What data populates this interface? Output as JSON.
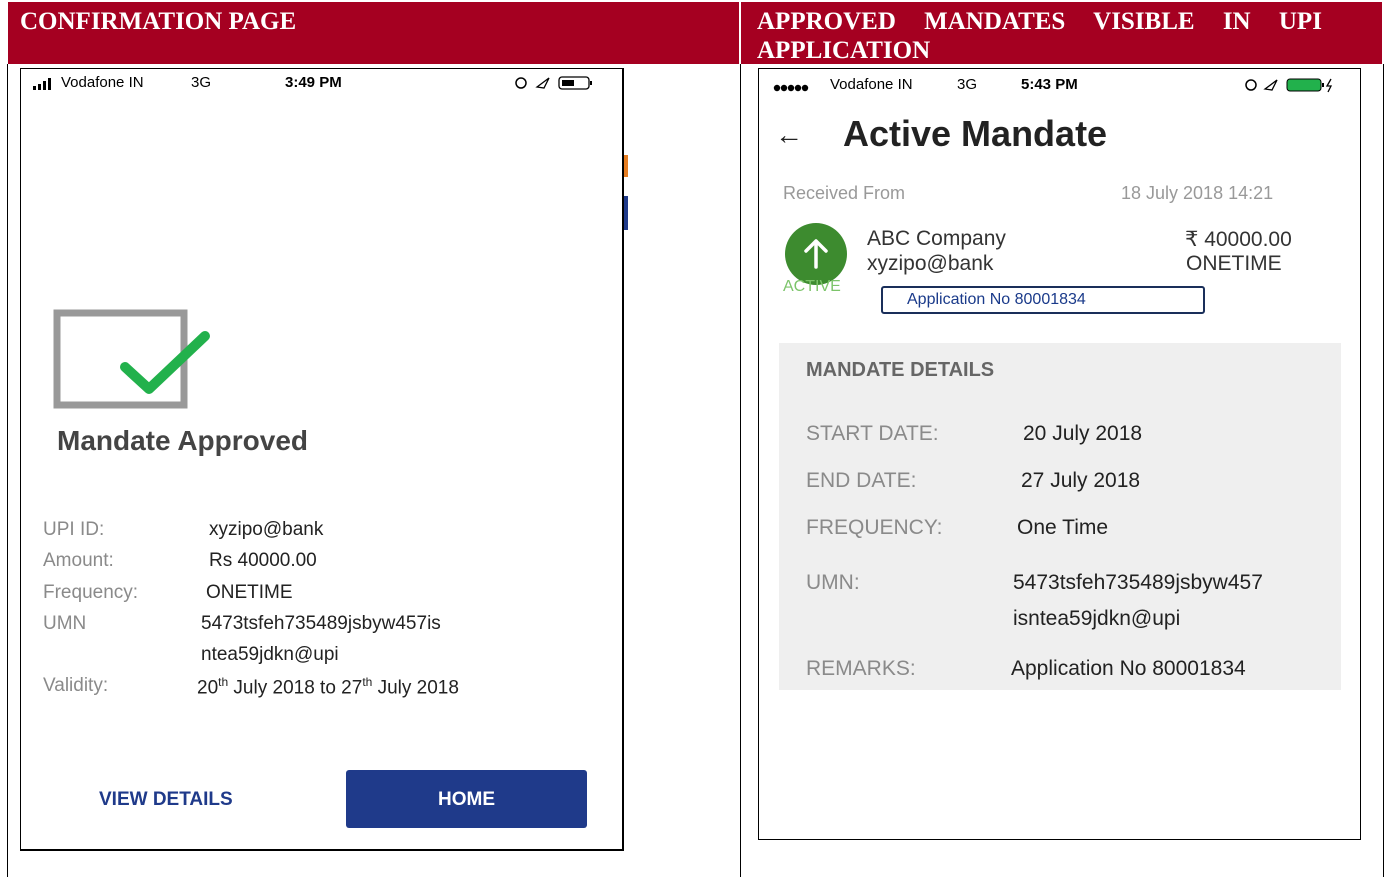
{
  "left_header": "CONFIRMATION PAGE",
  "right_header_line1": "APPROVED MANDATES VISIBLE IN UPI",
  "right_header_line2": "APPLICATION",
  "left_phone": {
    "status_carrier": "Vodafone IN",
    "status_network": "3G",
    "status_time": "3:49 PM",
    "title": "Mandate Approved",
    "upi_label": "UPI ID:",
    "upi_value": "xyzipo@bank",
    "amount_label": "Amount:",
    "amount_value": "Rs 40000.00",
    "frequency_label": "Frequency:",
    "frequency_value": "ONETIME",
    "umn_label": "UMN",
    "umn_line1": "5473tsfeh735489jsbyw457is",
    "umn_line2": "ntea59jdkn@upi",
    "validity_label": "Validity:",
    "validity_start_day": "20",
    "validity_start_sup": "th",
    "validity_mid": " July 2018 to 27",
    "validity_end_sup": "th",
    "validity_end": " July 2018",
    "view_details_label": "VIEW DETAILS",
    "home_label": "HOME"
  },
  "right_phone": {
    "status_carrier": "Vodafone IN",
    "status_network": "3G",
    "status_time": "5:43 PM",
    "back_glyph": "←",
    "title": "Active Mandate",
    "received_label": "Received From",
    "received_date": "18 July 2018 14:21",
    "payee_name": "ABC Company",
    "payee_vpa": "xyzipo@bank",
    "amount": "₹ 40000.00",
    "frequency": "ONETIME",
    "status": "ACTIVE",
    "application_box": "Application No 80001834",
    "details_title": "MANDATE DETAILS",
    "start_label": "START DATE:",
    "start_value": "20 July 2018",
    "end_label": "END DATE:",
    "end_value": "27 July 2018",
    "freq_label": "FREQUENCY:",
    "freq_value": "One Time",
    "umn_label": "UMN:",
    "umn_line1": "5473tsfeh735489jsbyw457",
    "umn_line2": "isntea59jdkn@upi",
    "remarks_label": "REMARKS:",
    "remarks_value": "Application No 80001834"
  },
  "colors": {
    "header_bg": "#a50021",
    "home_button": "#1f3a8a",
    "check_green": "#22b14c",
    "active_green": "#3d8b2f",
    "details_bg": "#efefef",
    "app_box_border": "#1a2f5a"
  }
}
